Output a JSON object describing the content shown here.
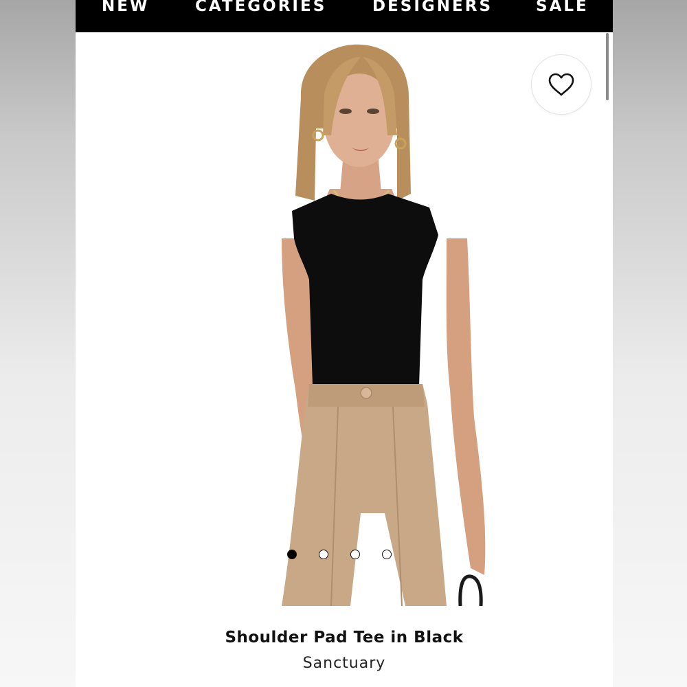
{
  "nav": {
    "items": [
      {
        "label": "NEW"
      },
      {
        "label": "CATEGORIES"
      },
      {
        "label": "DESIGNERS"
      },
      {
        "label": "SALE"
      }
    ]
  },
  "product": {
    "name": "Shoulder Pad Tee in Black",
    "brand": "Sanctuary",
    "image_alt": "Model wearing black shoulder pad tee with tan trousers",
    "wishlisted": false
  },
  "carousel": {
    "total": 4,
    "active_index": 0
  },
  "colors": {
    "nav_bg": "#000000",
    "nav_text": "#ffffff",
    "tee": "#0d0d0d",
    "trousers": "#c9a887",
    "skin": "#d9a98a",
    "hair": "#b88f5c"
  },
  "icons": {
    "wishlist": "heart-outline-icon"
  }
}
